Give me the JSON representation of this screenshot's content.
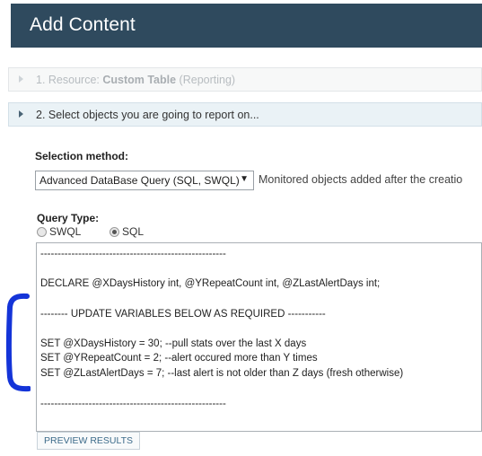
{
  "header": {
    "title": "Add Content"
  },
  "steps": {
    "step1": {
      "prefix": "1. Resource: ",
      "resource": "Custom Table",
      "suffix": " (Reporting)"
    },
    "step2": {
      "label": "2. Select objects you are going to report on..."
    }
  },
  "selection": {
    "label": "Selection method:",
    "value": "Advanced DataBase Query (SQL, SWQL)",
    "note": "Monitored objects added after the creatio"
  },
  "query_type": {
    "label": "Query Type:",
    "options": [
      {
        "label": "SWQL",
        "selected": false
      },
      {
        "label": "SQL",
        "selected": true
      }
    ]
  },
  "query_lines": [
    "------------------------------------------------------",
    "",
    "DECLARE @XDaysHistory int, @YRepeatCount int, @ZLastAlertDays int;",
    "",
    "-------- UPDATE VARIABLES BELOW AS REQUIRED -----------",
    "",
    "SET @XDaysHistory = 30; --pull stats over the last X days",
    "SET @YRepeatCount = 2; --alert occured more than Y times",
    "SET @ZLastAlertDays = 7; --last alert is not older than Z days (fresh otherwise)",
    "",
    "------------------------------------------------------"
  ],
  "buttons": {
    "preview": "PREVIEW RESULTS"
  },
  "annotation_color": "#1434d8"
}
